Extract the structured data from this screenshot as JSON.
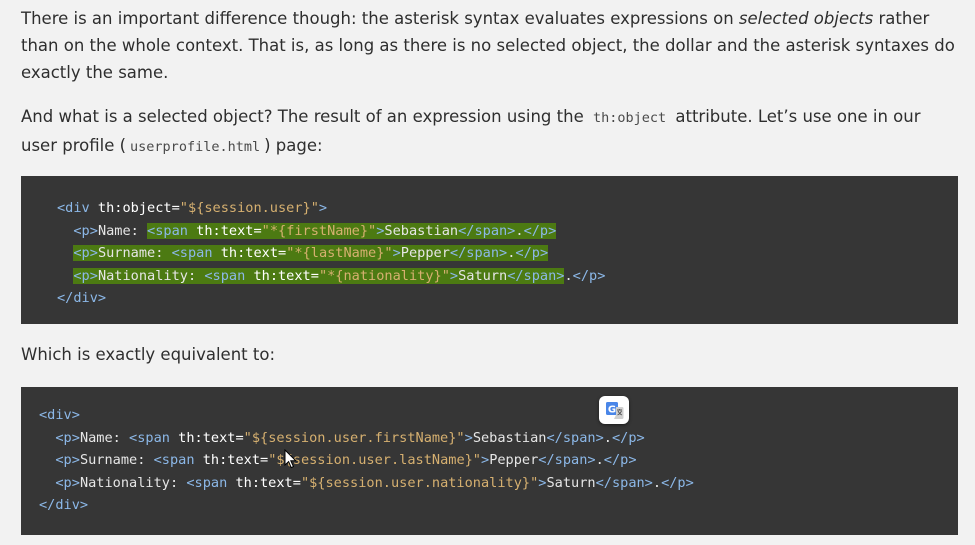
{
  "paragraph1": {
    "part1": "There is an important difference though: the asterisk syntax evaluates expressions on ",
    "emphasis": "selected objects",
    "part2": " rather than on the whole context. That is, as long as there is no selected object, the dollar and the asterisk syntaxes do exactly the same."
  },
  "paragraph2": {
    "part1": "And what is a selected object? The result of an expression using the ",
    "code1": "th:object",
    "part2": " attribute. Let’s use one in our user profile (",
    "code2": "userprofile.html",
    "part3": ") page:"
  },
  "paragraph3": {
    "text": "Which is exactly equivalent to:"
  },
  "code_block_1": {
    "l1": {
      "open": "<div",
      "attr": " th:object=",
      "val": "\"${session.user}\"",
      "close": ">"
    },
    "l2": {
      "indent": "  ",
      "p_open": "<p>",
      "label": "Name: ",
      "span_open": "<span",
      "attr": " th:text=",
      "val": "\"*{firstName}\"",
      "gt": ">",
      "content": "Sebastian",
      "span_close": "</span>",
      "end": ".",
      "p_close": "</p>"
    },
    "l3": {
      "indent": "  ",
      "p_open": "<p>",
      "label": "Surname: ",
      "span_open": "<span",
      "attr": " th:text=",
      "val": "\"*{lastName}\"",
      "gt": ">",
      "content": "Pepper",
      "span_close": "</span>",
      "end": ".",
      "p_close": "</p>"
    },
    "l4": {
      "indent": "  ",
      "p_open": "<p>",
      "label": "Nationality: ",
      "span_open": "<span",
      "attr": " th:text=",
      "val": "\"*{nationality}\"",
      "gt": ">",
      "content": "Saturn",
      "span_close": "</span>",
      "end": ".",
      "p_close": "</p>"
    },
    "l5": {
      "close": "</div>"
    }
  },
  "code_block_2": {
    "l1": {
      "open": "<div>"
    },
    "l2": {
      "indent": "  ",
      "p_open": "<p>",
      "label": "Name: ",
      "span_open": "<span",
      "attr": " th:text=",
      "val": "\"${session.user.firstName}\"",
      "gt": ">",
      "content": "Sebastian",
      "span_close": "</span>",
      "end": ".",
      "p_close": "</p>"
    },
    "l3": {
      "indent": "  ",
      "p_open": "<p>",
      "label": "Surname: ",
      "span_open": "<span",
      "attr": " th:text=",
      "val": "\"${session.user.lastName}\"",
      "gt": ">",
      "content": "Pepper",
      "span_close": "</span>",
      "end": ".",
      "p_close": "</p>"
    },
    "l4": {
      "indent": "  ",
      "p_open": "<p>",
      "label": "Nationality: ",
      "span_open": "<span",
      "attr": " th:text=",
      "val": "\"${session.user.nationality}\"",
      "gt": ">",
      "content": "Saturn",
      "span_close": "</span>",
      "end": ".",
      "p_close": "</p>"
    },
    "l5": {
      "close": "</div>"
    }
  },
  "overlays": {
    "translate_icon": "google-translate-icon",
    "cursor_icon": "mouse-pointer-icon"
  },
  "colors": {
    "page_background": "#f2f2f2",
    "code_background": "#363636",
    "selection_highlight": "#4c7a12",
    "tag_color": "#8cb8e8",
    "string_color": "#d6b070"
  }
}
